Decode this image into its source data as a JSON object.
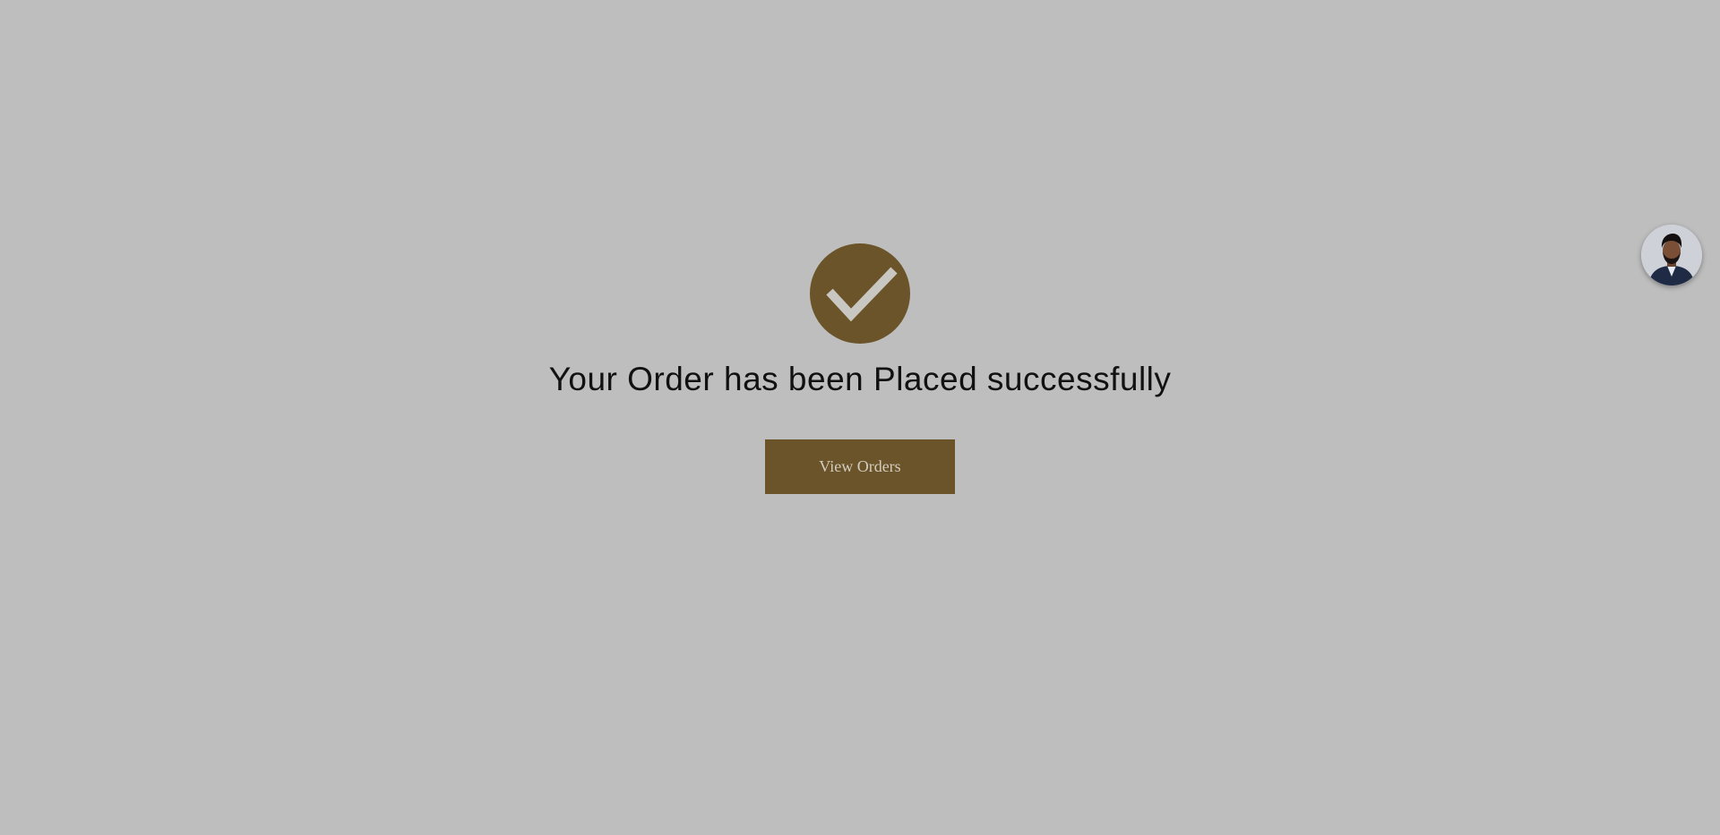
{
  "confirmation": {
    "icon": "check-circle-icon",
    "message": "Your Order has been Placed successfully",
    "button_label": "View Orders"
  },
  "chat_widget": {
    "icon": "avatar-icon"
  },
  "colors": {
    "background": "#bebebe",
    "accent": "#6b5429",
    "check_mark": "#c9c7c2",
    "button_text": "#d3cdbf",
    "headline_text": "#111111"
  }
}
